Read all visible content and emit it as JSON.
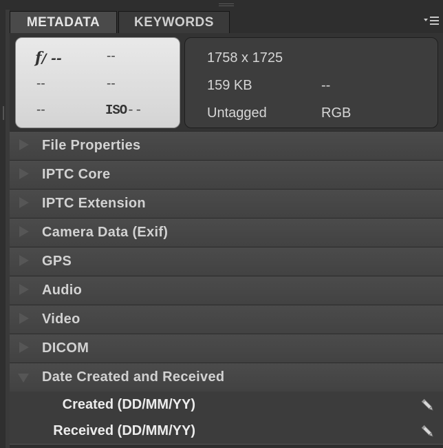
{
  "tabs": [
    {
      "label": "METADATA",
      "active": true
    },
    {
      "label": "KEYWORDS",
      "active": false
    }
  ],
  "panel_menu": {
    "icon": "panel-menu-icon"
  },
  "camera": {
    "f_symbol": "f",
    "f_value": "/ --",
    "shutter": "--",
    "exposure_comp": "--",
    "focal": "--",
    "white_balance": "--",
    "metering": "--",
    "iso_label": "ISO",
    "iso_value": "--"
  },
  "file_info": {
    "dimensions": "1758 x 1725",
    "size": "159 KB",
    "resolution": "--",
    "color_profile": "Untagged",
    "color_mode": "RGB"
  },
  "sections": [
    {
      "label": "File Properties",
      "open": false
    },
    {
      "label": "IPTC Core",
      "open": false
    },
    {
      "label": "IPTC Extension",
      "open": false
    },
    {
      "label": "Camera Data (Exif)",
      "open": false
    },
    {
      "label": "GPS",
      "open": false
    },
    {
      "label": "Audio",
      "open": false
    },
    {
      "label": "Video",
      "open": false
    },
    {
      "label": "DICOM",
      "open": false
    },
    {
      "label": "Date Created and Received",
      "open": true
    }
  ],
  "date_fields": [
    {
      "label": "Created (DD/MM/YY)",
      "icon": "pencil-icon"
    },
    {
      "label": "Received (DD/MM/YY)",
      "icon": "pencil-icon"
    }
  ],
  "colors": {
    "panel_bg": "#3a3a3a",
    "section_bg": "#474747",
    "camera_box_bg": "#e0e0e0",
    "text": "#d6d6d6"
  }
}
